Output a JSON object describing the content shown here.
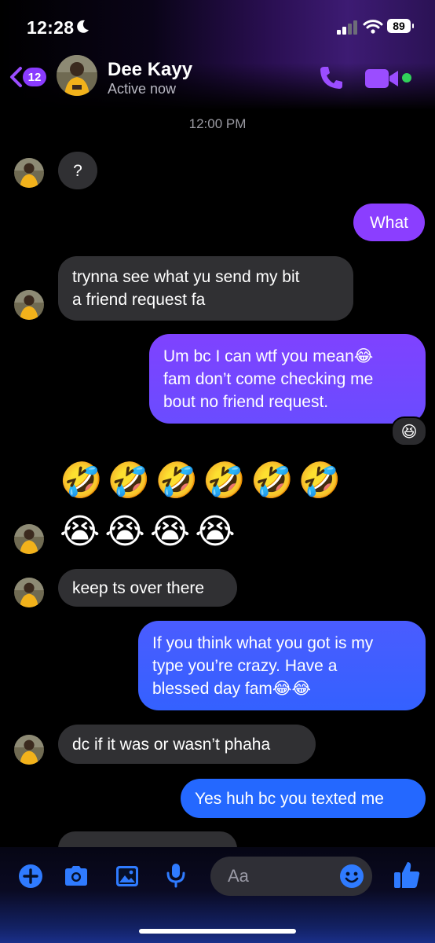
{
  "status_bar": {
    "time": "12:28",
    "battery": "89"
  },
  "header": {
    "back_count": "12",
    "contact_name": "Dee Kayy",
    "presence": "Active now"
  },
  "timestamp": "12:00 PM",
  "messages": [
    {
      "side": "in",
      "text": "?"
    },
    {
      "side": "out",
      "text": "What"
    },
    {
      "side": "in",
      "lines": [
        "trynna see what yu send my bit",
        "a friend request fa"
      ]
    },
    {
      "side": "out",
      "lines": [
        "Um bc I can wtf you mean😂",
        "fam don’t come checking me",
        "bout no friend request."
      ],
      "reaction": "😆"
    },
    {
      "side": "in",
      "emoji_rows": [
        "🤣🤣🤣🤣🤣🤣",
        "😭😭😭😭"
      ]
    },
    {
      "side": "in",
      "text": "keep ts over there"
    },
    {
      "side": "out",
      "lines": [
        "If you think what you got is my",
        "type you’re crazy. Have a",
        "blessed day fam😂😂"
      ]
    },
    {
      "side": "in",
      "text": "dc if it was or wasn’t phaha"
    },
    {
      "side": "out",
      "text": "Yes huh bc you texted me"
    }
  ],
  "composer": {
    "placeholder": "Aa"
  },
  "colors": {
    "accent": "#9b4dff",
    "incoming": "#303033",
    "outgoing_top": "#8a3cff",
    "outgoing_bottom": "#1f6bff"
  }
}
